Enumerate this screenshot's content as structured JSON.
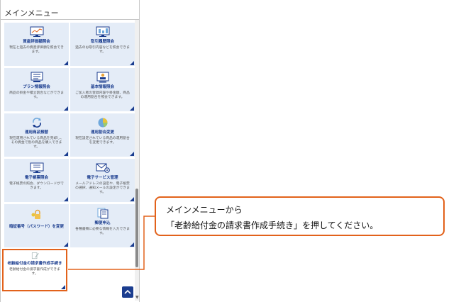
{
  "menu": {
    "title": "メインメニュー"
  },
  "tiles": [
    {
      "title": "資産評価額照会",
      "desc": "現在と過去の資産評価額を照会できます。",
      "icon": "monitor-chart-icon"
    },
    {
      "title": "取引履歴照会",
      "desc": "過去のお取引内容などを照会できます。",
      "icon": "monitor-history-icon"
    },
    {
      "title": "プラン情報照会",
      "desc": "商品の掛金や積立割合などができます。",
      "icon": "document-list-icon"
    },
    {
      "title": "基本情報照会",
      "desc": "ご加入者の登録内容や掛金額、商品の運用割合を照会できます。",
      "icon": "profile-card-icon"
    },
    {
      "title": "運用商品預替",
      "desc": "現在運用されている商品を売却し、その資金で別の商品を購入できます。",
      "icon": "cycle-arrows-icon"
    },
    {
      "title": "運用割合変更",
      "desc": "現在設定されている商品の運用割合を変更できます。",
      "icon": "pie-chart-icon"
    },
    {
      "title": "電子帳票照会",
      "desc": "電子帳票の照会、ダウンロードができます。",
      "icon": "monitor-document-icon"
    },
    {
      "title": "電子サービス管理",
      "desc": "メールアドレスの設定や、電子帳票の選択、通知メールの設定ができます。",
      "icon": "mail-gear-icon"
    },
    {
      "title": "暗証番号（パスワード）を変更",
      "desc": "",
      "icon": "lock-icon"
    },
    {
      "title": "郵便申込",
      "desc": "各種書類に必要な情報を入力できます。",
      "icon": "document-stack-icon"
    },
    {
      "title": "老齢給付金の請求書作成手続き",
      "desc": "老齢給付金の請求書作成ができます。",
      "icon": "pen-document-icon"
    }
  ],
  "callout": {
    "line1": "メインメニューから",
    "line2": "「老齢給付金の請求書作成手続き」を押してください。"
  },
  "colors": {
    "accent": "#e2621b",
    "brand": "#1b3d8f",
    "tile_bg": "#e4ecf7"
  }
}
